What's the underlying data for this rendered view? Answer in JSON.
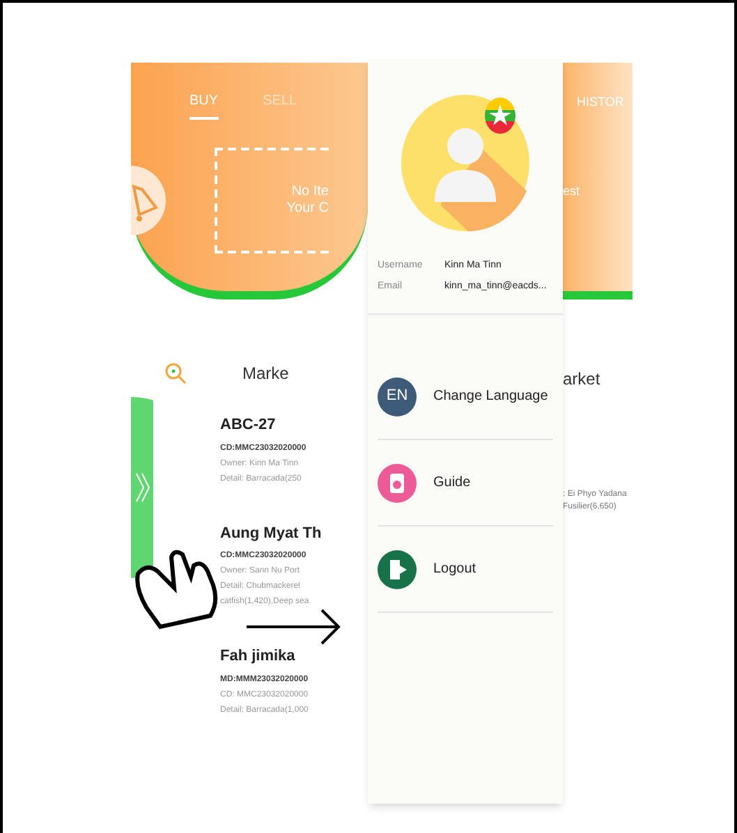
{
  "buy_screen": {
    "tabs": [
      {
        "label": "BUY",
        "selected": true
      },
      {
        "label": "SELL",
        "selected": false
      }
    ],
    "empty_cart": [
      "No Ite",
      "Your C"
    ],
    "section_title": "Marke",
    "items": [
      {
        "title": "ABC-27",
        "code": "CD:MMC23032020000",
        "lines": [
          "Owner: Kinn Ma Tinn",
          "Detail: Barracada(250"
        ]
      },
      {
        "title": "Aung Myat Th",
        "code": "CD:MMC23032020000",
        "lines": [
          "Owner: Sann Nu  Port",
          "Detail: Chubmackerel",
          "catfish(1,420),Deep sea"
        ]
      },
      {
        "title": "Fah jimika",
        "code": "MD:MMM23032020000",
        "lines": [
          "CD: MMC23032020000",
          "Detail: Barracada(1,000"
        ]
      }
    ]
  },
  "drawer": {
    "fields": [
      {
        "label": "Username",
        "value": "Kinn Ma Tinn"
      },
      {
        "label": "Email",
        "value": "kinn_ma_tinn@eacds..."
      }
    ],
    "menu": [
      {
        "kind": "language",
        "badge": "EN",
        "label": "Change Language"
      },
      {
        "kind": "guide",
        "label": "Guide"
      },
      {
        "kind": "logout",
        "label": "Logout"
      }
    ]
  },
  "history_screen": {
    "tab": "HISTOR",
    "empty_text": "est",
    "section_title": "arket",
    "item_lines": [
      ": Ei Phyo Yadana",
      "Fusilier(6,650)"
    ]
  }
}
